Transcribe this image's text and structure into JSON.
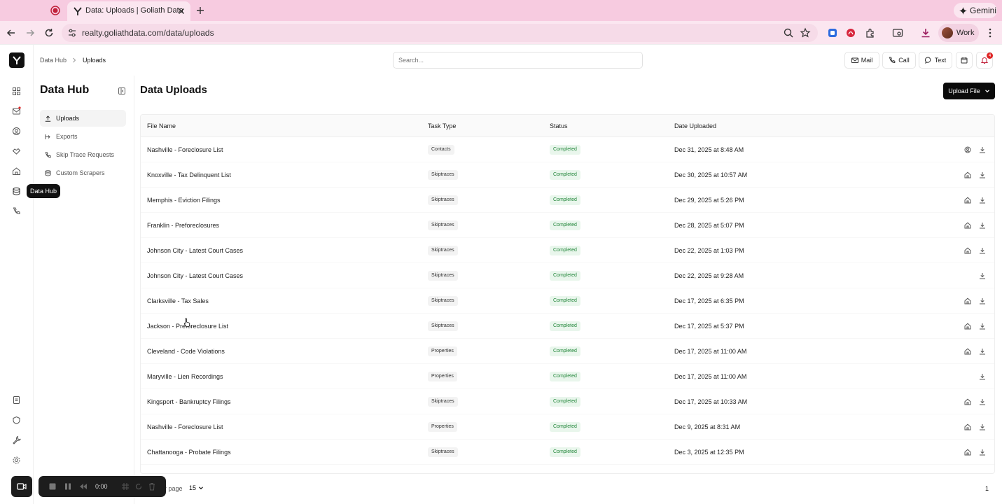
{
  "browser": {
    "tab_title": "Data: Uploads | Goliath Data",
    "url": "realty.goliathdata.com/data/uploads",
    "gemini_label": "Gemini",
    "profile_label": "Work"
  },
  "topbar": {
    "breadcrumb": [
      "Data Hub",
      "Uploads"
    ],
    "search_placeholder": "Search...",
    "mail_label": "Mail",
    "call_label": "Call",
    "text_label": "Text",
    "notification_count": "4"
  },
  "rail": {
    "tooltip": "Data Hub"
  },
  "sidepanel": {
    "title": "Data Hub",
    "items": [
      {
        "label": "Uploads",
        "icon": "upload-icon",
        "active": true
      },
      {
        "label": "Exports",
        "icon": "export-icon",
        "active": false
      },
      {
        "label": "Skip Trace Requests",
        "icon": "phone-icon",
        "active": false
      },
      {
        "label": "Custom Scrapers",
        "icon": "database-icon",
        "active": false
      }
    ]
  },
  "main": {
    "title": "Data Uploads",
    "upload_button": "Upload File",
    "columns": [
      "File Name",
      "Task Type",
      "Status",
      "Date Uploaded"
    ],
    "rows": [
      {
        "name": "Nashville - Foreclosure List",
        "type": "Contacts",
        "status": "Completed",
        "date": "Dec 31, 2025 at 8:48 AM",
        "row_icon": "contact-icon"
      },
      {
        "name": "Knoxville - Tax Delinquent List",
        "type": "Skiptraces",
        "status": "Completed",
        "date": "Dec 30, 2025 at 10:57 AM",
        "row_icon": "home-icon"
      },
      {
        "name": "Memphis - Eviction Filings",
        "type": "Skiptraces",
        "status": "Completed",
        "date": "Dec 29, 2025 at 5:26 PM",
        "row_icon": "home-icon"
      },
      {
        "name": "Franklin - Preforeclosures",
        "type": "Skiptraces",
        "status": "Completed",
        "date": "Dec 28, 2025 at 5:07 PM",
        "row_icon": "home-icon"
      },
      {
        "name": "Johnson City - Latest Court Cases",
        "type": "Skiptraces",
        "status": "Completed",
        "date": "Dec 22, 2025 at 1:03 PM",
        "row_icon": "home-icon"
      },
      {
        "name": "Johnson City - Latest Court Cases",
        "type": "Skiptraces",
        "status": "Completed",
        "date": "Dec 22, 2025 at 9:28 AM",
        "row_icon": ""
      },
      {
        "name": "Clarksville - Tax Sales",
        "type": "Skiptraces",
        "status": "Completed",
        "date": "Dec 17, 2025 at 6:35 PM",
        "row_icon": "home-icon"
      },
      {
        "name": "Jackson - Preforeclosure List",
        "type": "Skiptraces",
        "status": "Completed",
        "date": "Dec 17, 2025 at 5:37 PM",
        "row_icon": "home-icon"
      },
      {
        "name": "Cleveland - Code Violations",
        "type": "Properties",
        "status": "Completed",
        "date": "Dec 17, 2025 at 11:00 AM",
        "row_icon": "home-icon"
      },
      {
        "name": "Maryville - Lien Recordings",
        "type": "Properties",
        "status": "Completed",
        "date": "Dec 17, 2025 at 11:00 AM",
        "row_icon": ""
      },
      {
        "name": "Kingsport - Bankruptcy Filings",
        "type": "Skiptraces",
        "status": "Completed",
        "date": "Dec 17, 2025 at 10:33 AM",
        "row_icon": "home-icon"
      },
      {
        "name": "Nashville - Foreclosure List",
        "type": "Properties",
        "status": "Completed",
        "date": "Dec 9, 2025 at 8:31 AM",
        "row_icon": "home-icon"
      },
      {
        "name": "Chattanooga - Probate Filings",
        "type": "Skiptraces",
        "status": "Completed",
        "date": "Dec 3, 2025 at 12:35 PM",
        "row_icon": "home-icon"
      }
    ]
  },
  "footer": {
    "per_page_label": "r page",
    "per_page_value": "15",
    "page_number": "1"
  },
  "recorder": {
    "time": "0:00"
  },
  "colors": {
    "tabbar": "#f7cbe0",
    "status_green": "#22863a",
    "status_bg": "#e9f6ec",
    "primary_button": "#0b0b0b",
    "badge_red": "#e02424"
  }
}
